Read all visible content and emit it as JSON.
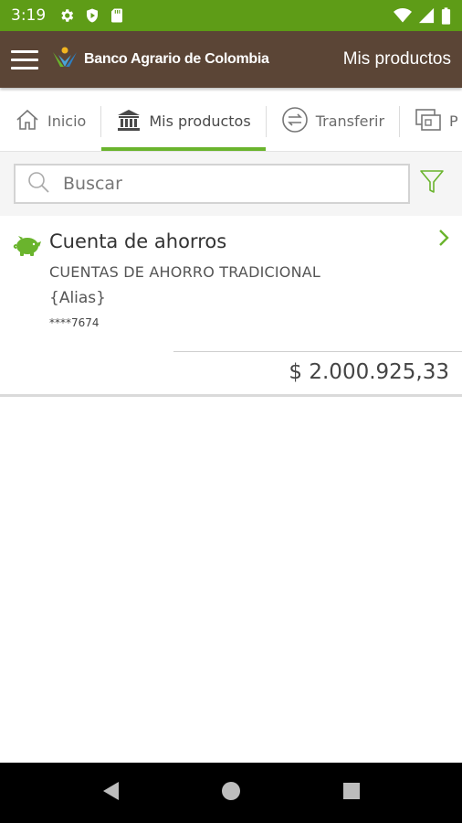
{
  "status_bar": {
    "time": "3:19",
    "icons_left": [
      "gear-icon",
      "play-protect-icon",
      "sd-card-icon"
    ],
    "icons_right": [
      "wifi-icon",
      "signal-icon",
      "battery-icon"
    ]
  },
  "app_bar": {
    "logo_text": "Banco Agrario de Colombia",
    "title": "Mis productos"
  },
  "tabs": [
    {
      "label": "Inicio",
      "icon": "home-icon",
      "active": false
    },
    {
      "label": "Mis productos",
      "icon": "bank-icon",
      "active": true
    },
    {
      "label": "Transferir",
      "icon": "transfer-icon",
      "active": false
    },
    {
      "label": "P",
      "icon": "payments-icon",
      "active": false
    }
  ],
  "search": {
    "placeholder": "Buscar",
    "value": ""
  },
  "products": [
    {
      "name": "Cuenta de ahorros",
      "type": "CUENTAS DE AHORRO TRADICIONAL",
      "alias": "{Alias}",
      "number": "****7674",
      "balance": "$ 2.000.925,33",
      "icon": "piggy-bank-icon"
    }
  ],
  "nav_bar": {
    "buttons": [
      "back-icon",
      "home-circle-icon",
      "recents-icon"
    ]
  },
  "colors": {
    "status_bar": "#5e9c17",
    "app_bar": "#5b4536",
    "accent": "#6ab42d"
  }
}
